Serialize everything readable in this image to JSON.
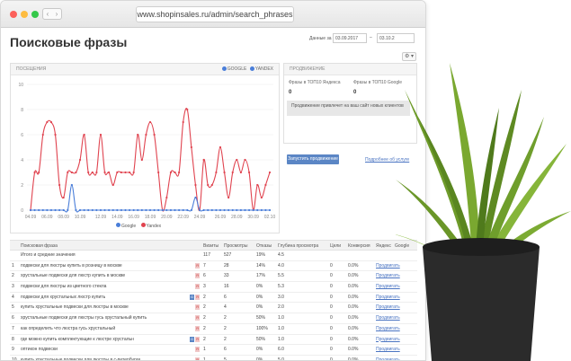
{
  "browser": {
    "url": "www.shopinsales.ru/admin/search_phrases",
    "nav_left": "‹",
    "nav_right": "›"
  },
  "page": {
    "title": "Поисковые фразы"
  },
  "date_filter": {
    "label": "Данные за",
    "from": "03.09.2017",
    "separator": "–",
    "to": "03.10.2"
  },
  "settings": {
    "icon": "⚙ ▾"
  },
  "visits_panel": {
    "heading": "ПОСЕЩЕНИЯ",
    "legend_google": "GOOGLE",
    "legend_yandex": "YANDEX",
    "bottom_legend_google": "Google",
    "bottom_legend_yandex": "Yandex"
  },
  "chart_data": {
    "type": "line",
    "x": [
      "04.09",
      "06.09",
      "08.09",
      "10.09",
      "12.09",
      "14.09",
      "16.09",
      "18.09",
      "20.09",
      "22.09",
      "24.09",
      "26.09",
      "28.09",
      "30.09",
      "02.10"
    ],
    "ylim": [
      0,
      10
    ],
    "yticks": [
      0,
      2,
      4,
      6,
      8,
      10
    ],
    "colors": {
      "google": "#4a7ed9",
      "yandex": "#e0434f"
    },
    "series": [
      {
        "name": "Google",
        "values": [
          0,
          0,
          0,
          0,
          0,
          0,
          0,
          0,
          0,
          0,
          2,
          0,
          0,
          0,
          0,
          0,
          0,
          0,
          0,
          0,
          0,
          0,
          0,
          0,
          0,
          0,
          0,
          0,
          0,
          0,
          0,
          0,
          0,
          0,
          0,
          0,
          0,
          0,
          0,
          0,
          1,
          0,
          0,
          0,
          0,
          0,
          0,
          0,
          0,
          0,
          0,
          0,
          0,
          0,
          0,
          0,
          0,
          0,
          0
        ]
      },
      {
        "name": "Yandex",
        "values": [
          0,
          3,
          3,
          6,
          7,
          7,
          6,
          2,
          1,
          3,
          3,
          3,
          4,
          6,
          3,
          3,
          3,
          6,
          3,
          3,
          2,
          3,
          3,
          3,
          3,
          3,
          6,
          4,
          6,
          7,
          6,
          3,
          0,
          1,
          3,
          3,
          3,
          7,
          8,
          5,
          2,
          0,
          4,
          2,
          2,
          3,
          5,
          3,
          1,
          3,
          4,
          3,
          4,
          3,
          0,
          2,
          1,
          2,
          3
        ]
      }
    ]
  },
  "promo_panel": {
    "heading": "ПРОДВИЖЕНИЕ",
    "yandex_label": "Фразы в ТОП10 Яндекса",
    "yandex_value": "0",
    "google_label": "Фразы в ТОП10 Google",
    "google_value": "0",
    "note": "Продвижение привлечет на ваш сайт новых клиентов",
    "button": "Запустить продвижение",
    "link": "Подробнее об услуге"
  },
  "table": {
    "headers": [
      "Поисковая фраза",
      "Визиты",
      "Просмотры",
      "Отказы",
      "Глубина просмотра",
      "Цели",
      "Конверсия",
      "Яндекс",
      "Google"
    ],
    "summary": {
      "phrase": "Итого и средние значения",
      "visits": "117",
      "views": "527",
      "bounce": "19%",
      "depth": "4.5",
      "goals": "",
      "conv": "",
      "yandex": "",
      "google": ""
    },
    "rows": [
      {
        "n": "1",
        "phrase": "подвески для люстры купить в розницу в москве",
        "badges": [
          "y"
        ],
        "visits": "7",
        "views": "28",
        "bounce": "14%",
        "depth": "4.0",
        "goals": "0",
        "conv": "0.0%",
        "action": "Продвигать"
      },
      {
        "n": "2",
        "phrase": "хрустальные подвески для люстр купить в москве",
        "badges": [
          "y"
        ],
        "visits": "6",
        "views": "33",
        "bounce": "17%",
        "depth": "5.5",
        "goals": "0",
        "conv": "0.0%",
        "action": "Продвигать"
      },
      {
        "n": "3",
        "phrase": "подвески для люстры из цветного стекла",
        "badges": [
          "y"
        ],
        "visits": "3",
        "views": "16",
        "bounce": "0%",
        "depth": "5.3",
        "goals": "0",
        "conv": "0.0%",
        "action": "Продвигать"
      },
      {
        "n": "4",
        "phrase": "подвески для хрустальных люстр купить",
        "badges": [
          "g",
          "y"
        ],
        "visits": "2",
        "views": "6",
        "bounce": "0%",
        "depth": "3.0",
        "goals": "0",
        "conv": "0.0%",
        "action": "Продвигать"
      },
      {
        "n": "5",
        "phrase": "купить хрустальные подвески для люстры в москве",
        "badges": [
          "y"
        ],
        "visits": "2",
        "views": "4",
        "bounce": "0%",
        "depth": "2.0",
        "goals": "0",
        "conv": "0.0%",
        "action": "Продвигать"
      },
      {
        "n": "6",
        "phrase": "хрустальные подвески для люстры гусь хрустальный купить",
        "badges": [
          "y"
        ],
        "visits": "2",
        "views": "2",
        "bounce": "50%",
        "depth": "1.0",
        "goals": "0",
        "conv": "0.0%",
        "action": "Продвигать"
      },
      {
        "n": "7",
        "phrase": "как определить что люстра гусь хрустальный",
        "badges": [
          "y"
        ],
        "visits": "2",
        "views": "2",
        "bounce": "100%",
        "depth": "1.0",
        "goals": "0",
        "conv": "0.0%",
        "action": "Продвигать"
      },
      {
        "n": "8",
        "phrase": "где можно купить комплектующие к люстре хрустальн",
        "badges": [
          "g",
          "y"
        ],
        "visits": "2",
        "views": "2",
        "bounce": "50%",
        "depth": "1.0",
        "goals": "0",
        "conv": "0.0%",
        "action": "Продвигать"
      },
      {
        "n": "9",
        "phrase": "оптикон подвески",
        "badges": [
          "y"
        ],
        "visits": "1",
        "views": "6",
        "bounce": "0%",
        "depth": "6.0",
        "goals": "0",
        "conv": "0.0%",
        "action": "Продвигать"
      },
      {
        "n": "10",
        "phrase": "купить хрустальные подвески для люстры в с-петербурге",
        "badges": [
          "y"
        ],
        "visits": "1",
        "views": "5",
        "bounce": "0%",
        "depth": "5.0",
        "goals": "0",
        "conv": "0.0%",
        "action": "Продвигать"
      }
    ]
  }
}
